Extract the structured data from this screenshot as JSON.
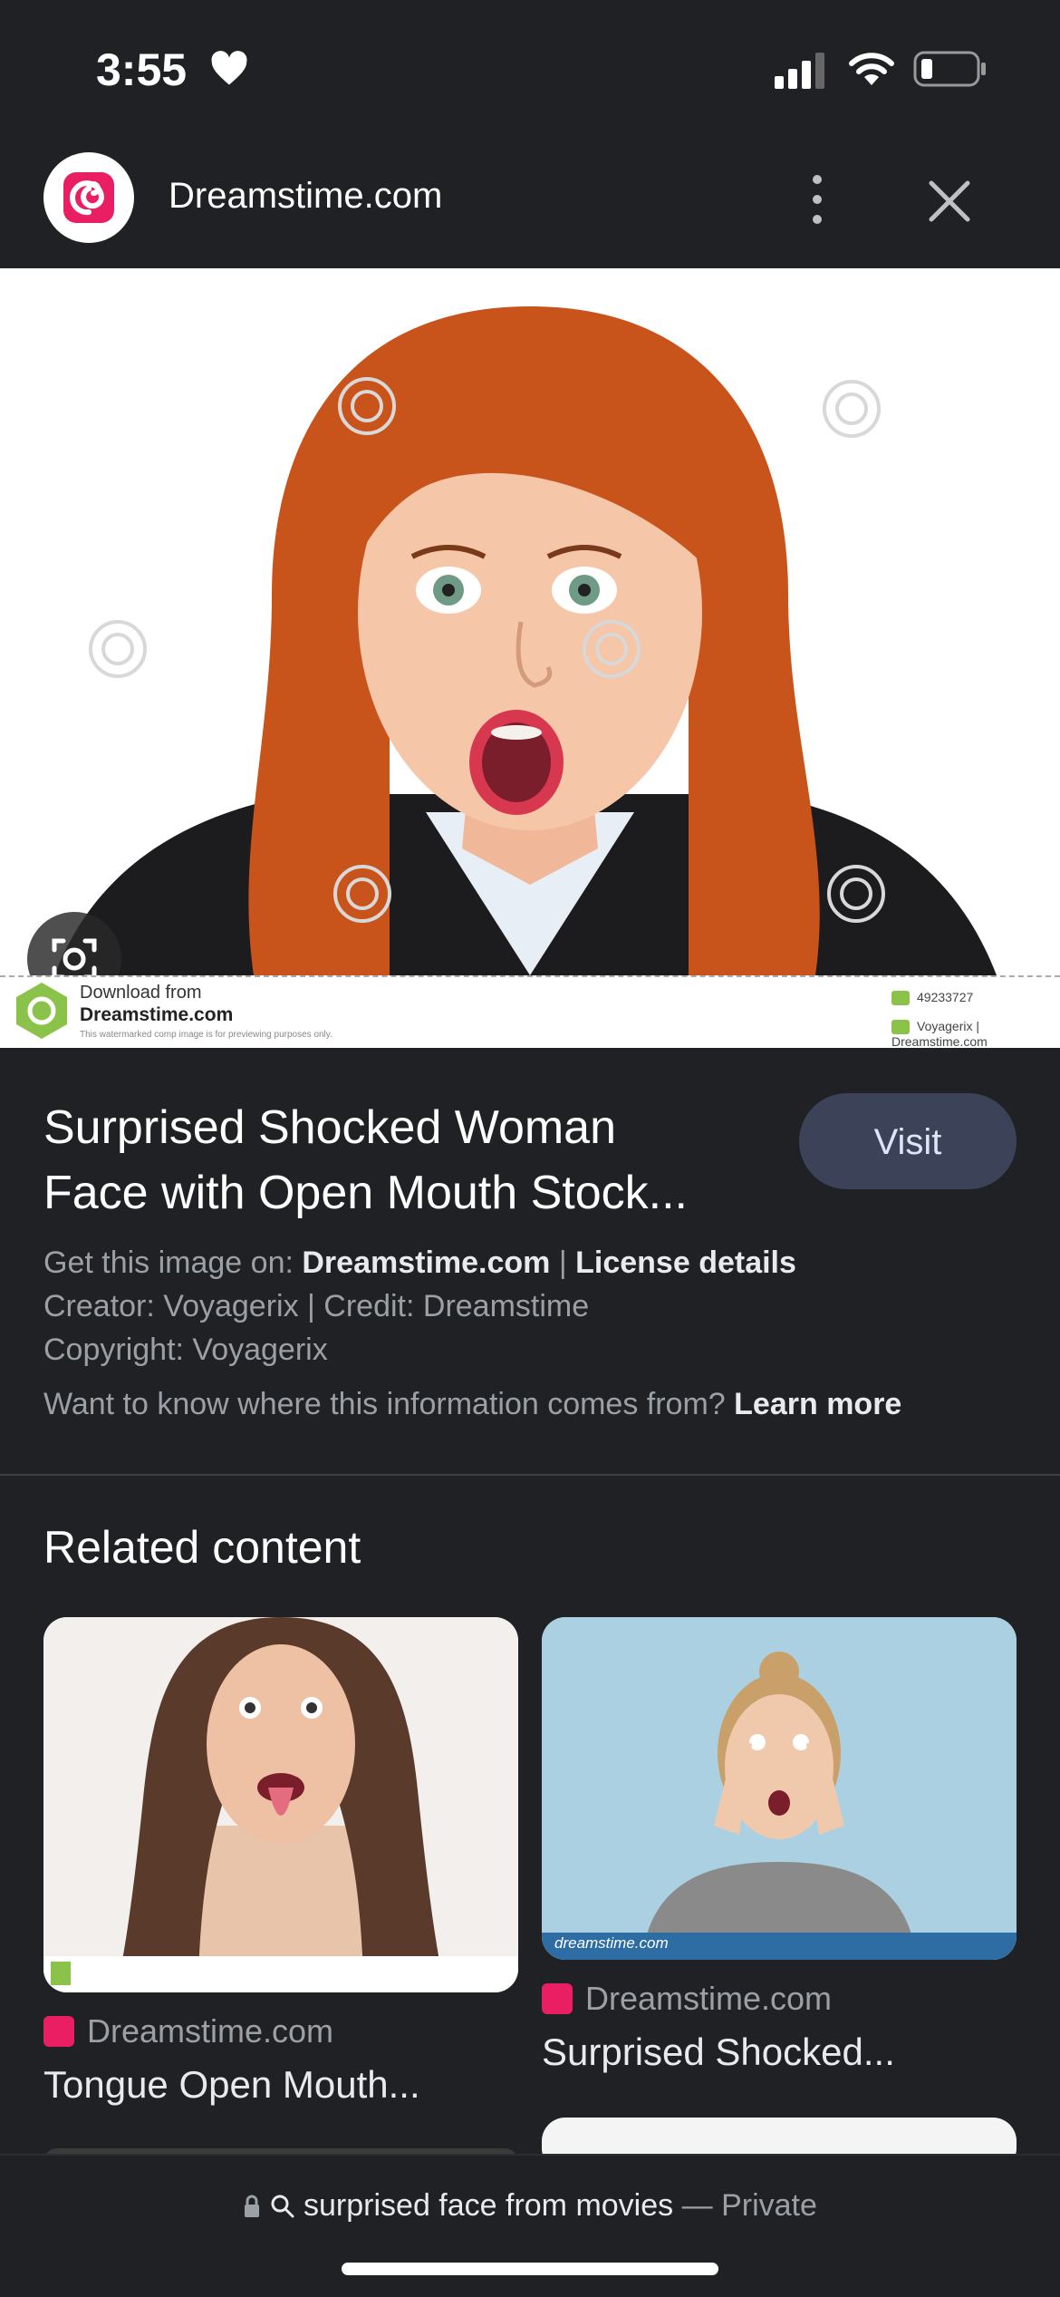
{
  "status_bar": {
    "time": "3:55"
  },
  "header": {
    "site_name": "Dreamstime.com"
  },
  "hero": {
    "download_from": "Download from",
    "brand": "Dreamstime.com",
    "note": "This watermarked comp image is for previewing purposes only.",
    "id_text": "49233727",
    "credit_text": "Voyagerix | Dreamstime.com"
  },
  "result": {
    "title_line1": "Surprised Shocked Woman",
    "title_line2": "Face with Open Mouth Stock...",
    "visit_label": "Visit",
    "get_image_prefix": "Get this image on: ",
    "get_image_site": "Dreamstime.com",
    "separator": " | ",
    "license_label": "License details",
    "creator_line": "Creator: Voyagerix | Credit: Dreamstime",
    "copyright_line": "Copyright: Voyagerix",
    "info_question": "Want to know where this information comes from? ",
    "learn_more": "Learn more"
  },
  "related": {
    "heading": "Related content",
    "items": [
      {
        "source": "Dreamstime.com",
        "title": "Tongue Open Mouth..."
      },
      {
        "source": "Dreamstime.com",
        "title": "Surprised Shocked..."
      }
    ],
    "item2_watermark": "dreamstime.com"
  },
  "bottom_bar": {
    "query": "surprised face from movies",
    "dash": " — ",
    "private_label": "Private"
  },
  "colors": {
    "background": "#202124",
    "visit_button": "#3c4358",
    "brand_pink": "#e91e63"
  }
}
